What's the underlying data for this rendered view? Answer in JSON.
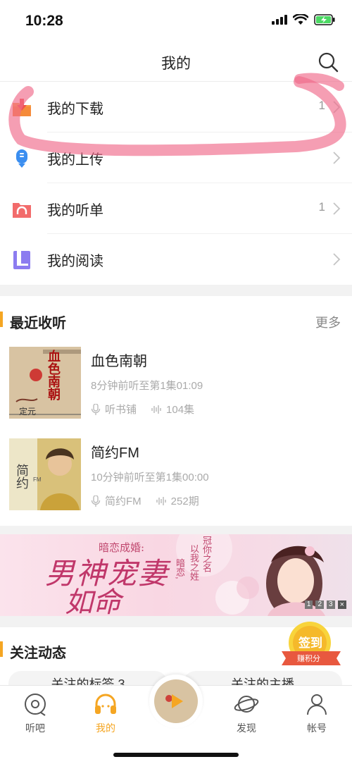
{
  "status_bar": {
    "time": "10:28"
  },
  "header": {
    "title": "我的"
  },
  "menu": [
    {
      "label": "我的下载",
      "count": "1",
      "icon": "download-icon"
    },
    {
      "label": "我的上传",
      "count": "",
      "icon": "upload-icon"
    },
    {
      "label": "我的听单",
      "count": "1",
      "icon": "playlist-icon"
    },
    {
      "label": "我的阅读",
      "count": "",
      "icon": "reading-icon"
    }
  ],
  "recent": {
    "title": "最近收听",
    "more": "更多",
    "items": [
      {
        "title": "血色南朝",
        "subtitle": "8分钟前听至第1集01:09",
        "source": "听书铺",
        "episodes": "104集",
        "cover_text": "血色南朝"
      },
      {
        "title": "简约FM",
        "subtitle": "10分钟前听至第1集00:00",
        "source": "简约FM",
        "episodes": "252期",
        "cover_text": "简约",
        "cover_badge": "FM"
      }
    ]
  },
  "banner": {
    "tagline": "暗恋成婚:",
    "main_line1": "男神宠妻",
    "main_line2": "如命",
    "vertical_text": [
      "暗恋,",
      "以我之姓",
      "冠你之名"
    ],
    "pages": [
      "1",
      "2",
      "3"
    ],
    "close": "×"
  },
  "follow": {
    "title": "关注动态",
    "tabs": [
      "关注的标签 3",
      "关注的主播"
    ]
  },
  "sign_in": {
    "label": "签到",
    "sub": "赚积分"
  },
  "tabbar": {
    "items": [
      {
        "label": "听吧",
        "icon": "vinyl-icon"
      },
      {
        "label": "我的",
        "icon": "headphones-icon",
        "active": true
      },
      {
        "label": "",
        "icon": "now-playing-cover"
      },
      {
        "label": "发现",
        "icon": "planet-icon"
      },
      {
        "label": "帐号",
        "icon": "account-icon"
      }
    ]
  },
  "colors": {
    "accent": "#f5a623",
    "annotation": "#f06a8a"
  }
}
